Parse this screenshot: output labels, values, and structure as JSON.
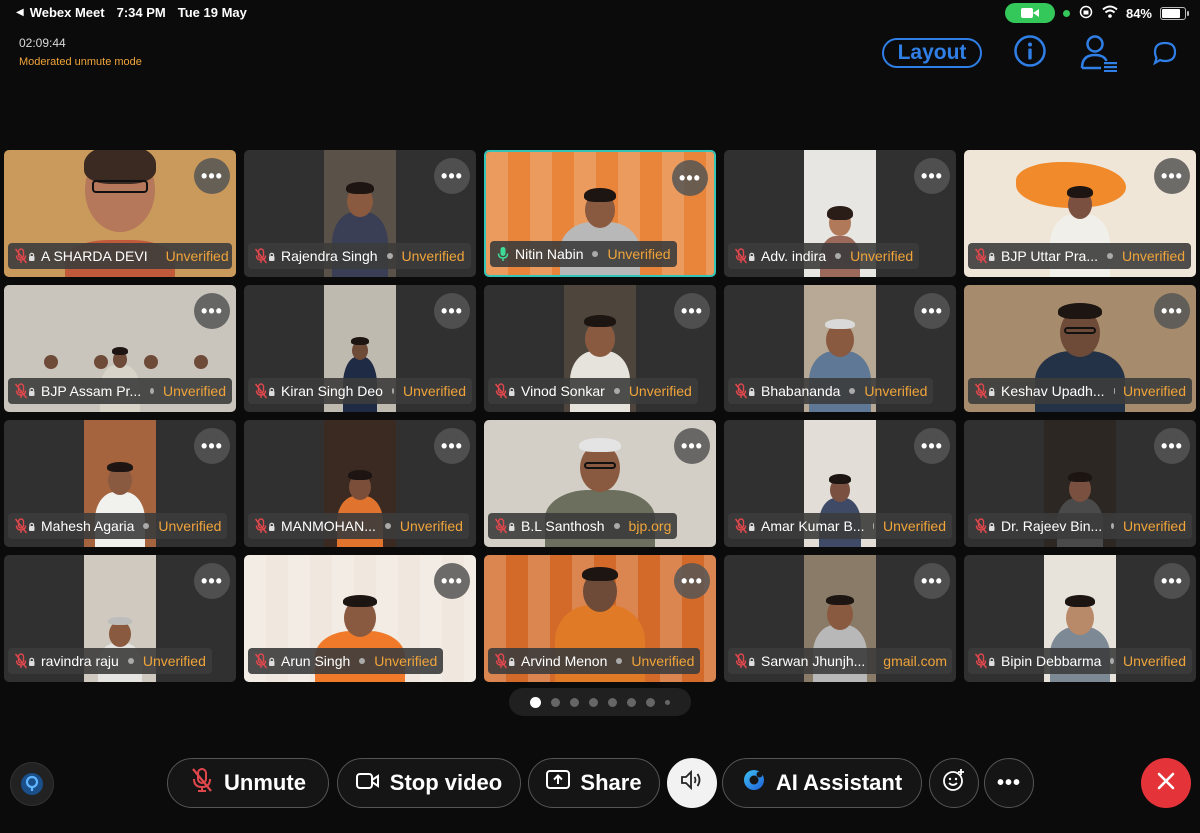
{
  "status_bar": {
    "app": "Webex Meet",
    "time": "7:34 PM",
    "date": "Tue 19 May",
    "battery": "84%",
    "battery_level": 0.84
  },
  "meeting": {
    "elapsed": "02:09:44",
    "mode": "Moderated unmute mode"
  },
  "top_controls": {
    "layout_label": "Layout",
    "info_icon": "info-icon",
    "participants_icon": "participants-icon",
    "chat_icon": "chat-icon"
  },
  "participants": [
    {
      "name": "A SHARDA DEVI",
      "status": "Unverified",
      "mic": "muted"
    },
    {
      "name": "Rajendra Singh",
      "status": "Unverified",
      "mic": "muted"
    },
    {
      "name": "Nitin Nabin",
      "status": "Unverified",
      "mic": "active"
    },
    {
      "name": "Adv. indira",
      "status": "Unverified",
      "mic": "muted"
    },
    {
      "name": "BJP Uttar Pra...",
      "status": "Unverified",
      "mic": "muted"
    },
    {
      "name": "BJP Assam Pr...",
      "status": "Unverified",
      "mic": "muted"
    },
    {
      "name": "Kiran Singh Deo",
      "status": "Unverified",
      "mic": "muted"
    },
    {
      "name": "Vinod Sonkar",
      "status": "Unverified",
      "mic": "muted"
    },
    {
      "name": "Bhabananda",
      "status": "Unverified",
      "mic": "muted"
    },
    {
      "name": "Keshav Upadh...",
      "status": "Unverified",
      "mic": "muted"
    },
    {
      "name": "Mahesh Agaria",
      "status": "Unverified",
      "mic": "muted"
    },
    {
      "name": "MANMOHAN...",
      "status": "Unverified",
      "mic": "muted"
    },
    {
      "name": "B.L Santhosh",
      "status": "bjp.org",
      "mic": "muted"
    },
    {
      "name": "Amar Kumar B...",
      "status": "Unverified",
      "mic": "muted"
    },
    {
      "name": "Dr. Rajeev Bin...",
      "status": "Unverified",
      "mic": "muted"
    },
    {
      "name": "ravindra raju",
      "status": "Unverified",
      "mic": "muted"
    },
    {
      "name": "Arun Singh",
      "status": "Unverified",
      "mic": "muted"
    },
    {
      "name": "Arvind Menon",
      "status": "Unverified",
      "mic": "muted"
    },
    {
      "name": "Sarwan Jhunjh...",
      "status": "gmail.com",
      "mic": "muted"
    },
    {
      "name": "Bipin Debbarma",
      "status": "Unverified",
      "mic": "muted"
    }
  ],
  "pager": {
    "pages": 8,
    "current": 1
  },
  "controls": {
    "unmute": "Unmute",
    "stop_video": "Stop video",
    "share": "Share",
    "ai_assistant": "AI Assistant"
  },
  "colors": {
    "accent_blue": "#2f7fe6",
    "status_orange": "#f0a43a",
    "end_red": "#e5333a",
    "active_speaker": "#34c5b8",
    "mute_red": "#e0474c"
  }
}
